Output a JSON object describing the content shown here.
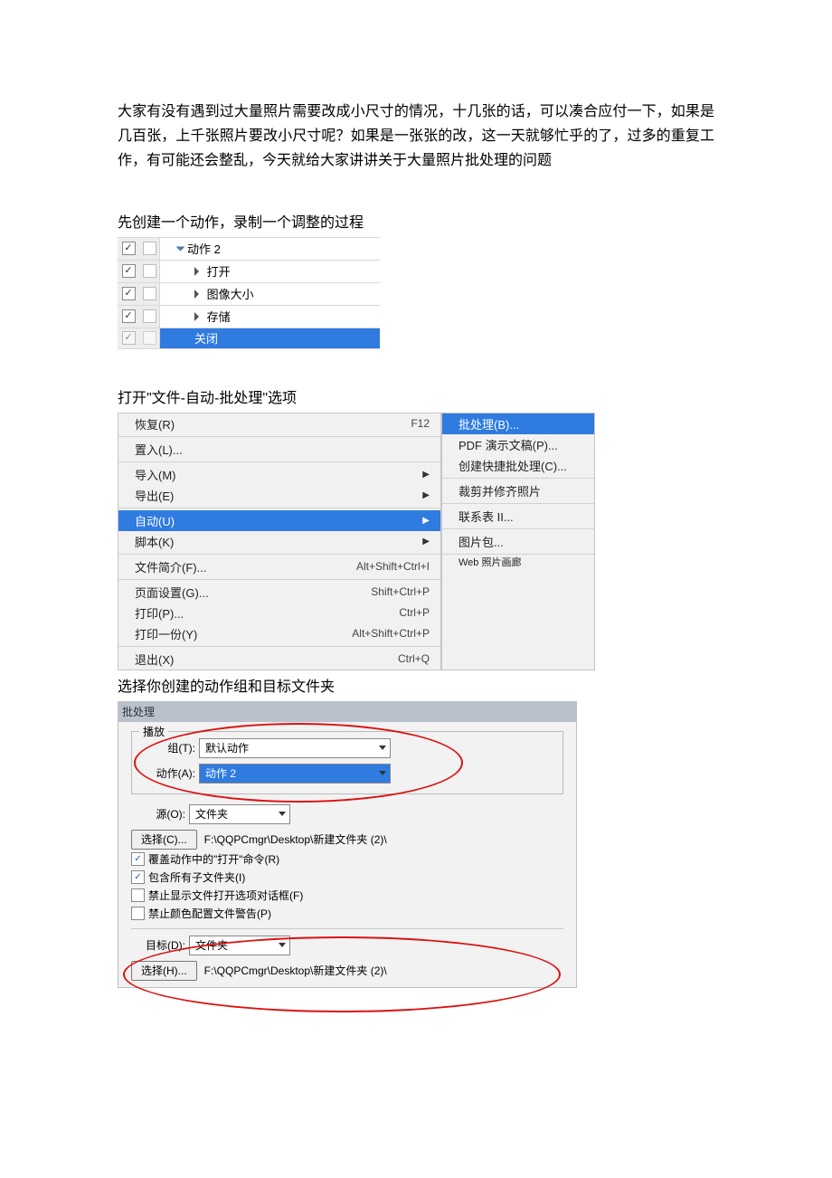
{
  "paragraphs": {
    "intro": "大家有没有遇到过大量照片需要改成小尺寸的情况，十几张的话，可以凑合应付一下，如果是几百张，上千张照片要改小尺寸呢？如果是一张张的改，这一天就够忙乎的了，过多的重复工作，有可能还会整乱，今天就给大家讲讲关于大量照片批处理的问题",
    "caption1": "先创建一个动作，录制一个调整的过程",
    "caption2": "打开\"文件-自动-批处理\"选项",
    "caption3": "选择你创建的动作组和目标文件夹"
  },
  "actions": {
    "action_name": "动作 2",
    "steps": {
      "open": "打开",
      "image_size": "图像大小",
      "save": "存储",
      "close": "关闭"
    }
  },
  "menu": {
    "main": {
      "restore": "恢复(R)",
      "restore_sc": "F12",
      "place": "置入(L)...",
      "import": "导入(M)",
      "export": "导出(E)",
      "auto": "自动(U)",
      "script": "脚本(K)",
      "file_info": "文件简介(F)...",
      "file_info_sc": "Alt+Shift+Ctrl+I",
      "page_setup": "页面设置(G)...",
      "page_setup_sc": "Shift+Ctrl+P",
      "print": "打印(P)...",
      "print_sc": "Ctrl+P",
      "print_one": "打印一份(Y)",
      "print_one_sc": "Alt+Shift+Ctrl+P",
      "exit": "退出(X)",
      "exit_sc": "Ctrl+Q"
    },
    "sub": {
      "batch": "批处理(B)...",
      "pdf": "PDF 演示文稿(P)...",
      "quick": "创建快捷批处理(C)...",
      "crop": "裁剪并修齐照片",
      "contact": "联系表 II...",
      "package": "图片包...",
      "web": "Web 照片画廊"
    }
  },
  "dialog": {
    "title": "批处理",
    "play_legend": "播放",
    "group_label": "组(T):",
    "group_value": "默认动作",
    "action_label": "动作(A):",
    "action_value": "动作 2",
    "source_label": "源(O):",
    "source_value": "文件夹",
    "choose_c": "选择(C)...",
    "path1": "F:\\QQPCmgr\\Desktop\\新建文件夹 (2)\\",
    "cb1": "覆盖动作中的\"打开\"命令(R)",
    "cb2": "包含所有子文件夹(I)",
    "cb3": "禁止显示文件打开选项对话框(F)",
    "cb4": "禁止颜色配置文件警告(P)",
    "dest_label": "目标(D):",
    "dest_value": "文件夹",
    "choose_h": "选择(H)...",
    "path2": "F:\\QQPCmgr\\Desktop\\新建文件夹 (2)\\"
  }
}
